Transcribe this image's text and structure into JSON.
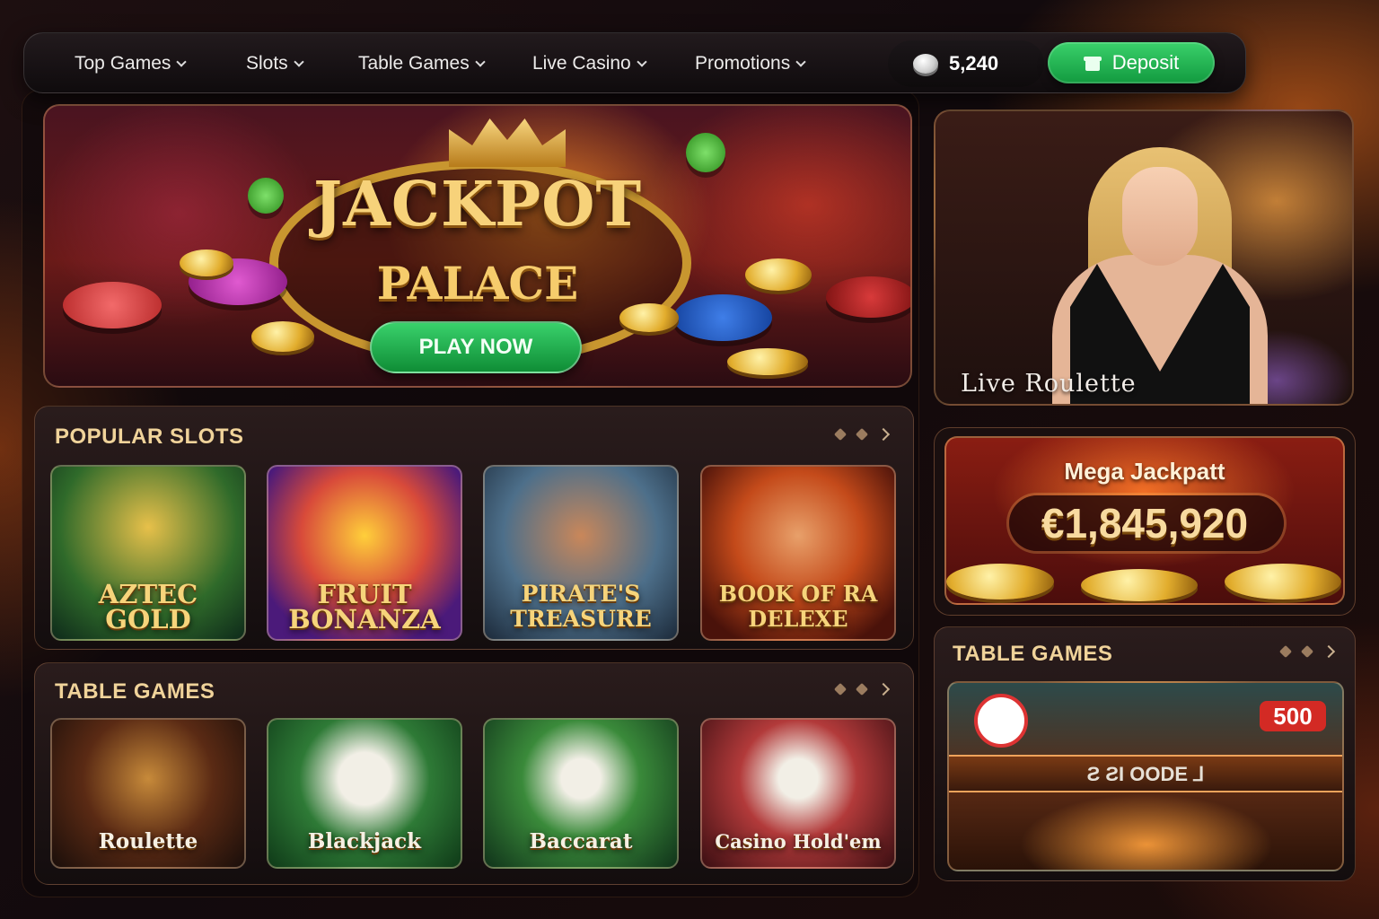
{
  "nav": {
    "items": [
      {
        "label": "Top Games"
      },
      {
        "label": "Slots"
      },
      {
        "label": "Table Games"
      },
      {
        "label": "Live Casino"
      },
      {
        "label": "Promotions"
      }
    ],
    "balance": "5,240",
    "balance_icon": "coin-icon",
    "deposit_label": "Deposit",
    "deposit_icon": "gift-icon"
  },
  "hero": {
    "title": "JACKPOT",
    "subtitle": "PALACE",
    "cta_label": "PLAY NOW"
  },
  "live": {
    "label": "Live Roulette"
  },
  "popular_slots": {
    "title": "POPULAR SLOTS",
    "games": [
      {
        "name_line1": "AZTEC",
        "name_line2": "GOLD"
      },
      {
        "name_line1": "FRUIT",
        "name_line2": "BONANZA"
      },
      {
        "name_line1": "PIRATE'S",
        "name_line2": "TREASURE"
      },
      {
        "name_line1": "BOOK OF RA",
        "name_line2": "DELEXE"
      }
    ]
  },
  "table_games": {
    "title": "TABLE GAMES",
    "games": [
      {
        "name": "Roulette"
      },
      {
        "name": "Blackjack"
      },
      {
        "name": "Baccarat"
      },
      {
        "name": "Casino Hold'em"
      }
    ]
  },
  "jackpot": {
    "title": "Mega Jackpatt",
    "amount": "€1,845,920"
  },
  "side_table": {
    "title": "TABLE GAMES",
    "badge": "500",
    "banner_text": "Ƨ ƧI OODE ⅃"
  },
  "colors": {
    "accent_green": "#1fb153",
    "gold": "#f6d47b",
    "header_text": "#f0d39a"
  }
}
